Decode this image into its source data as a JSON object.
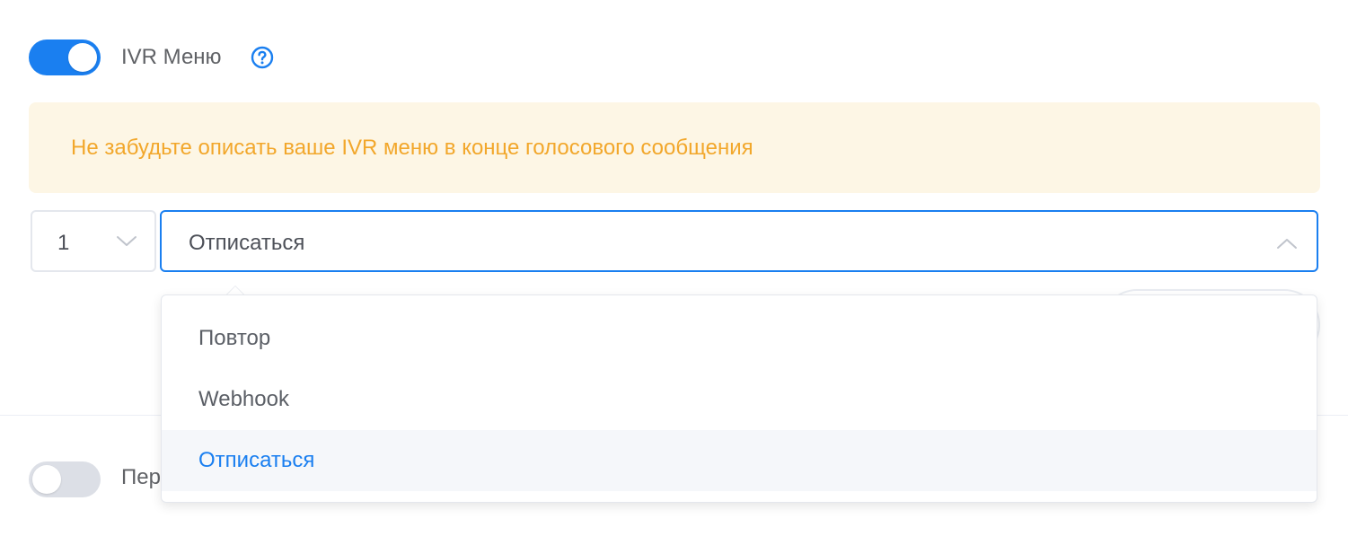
{
  "ivr": {
    "enabled": true,
    "label": "IVR Меню"
  },
  "alert": {
    "text": "Не забудьте описать ваше IVR меню в конце голосового сообщения"
  },
  "key_select": {
    "value": "1"
  },
  "action_select": {
    "value": "Отписаться",
    "options": [
      "Повтор",
      "Webhook",
      "Отписаться"
    ],
    "selected_index": 2
  },
  "second_toggle": {
    "enabled": false,
    "label_partial": "Пер"
  },
  "colors": {
    "accent": "#1a7ff0",
    "warning_text": "#f2a72b",
    "warning_bg": "#fdf6e5"
  },
  "icons": {
    "help": "question-circle-icon",
    "chevron_down": "chevron-down-icon",
    "chevron_up": "chevron-up-icon"
  }
}
